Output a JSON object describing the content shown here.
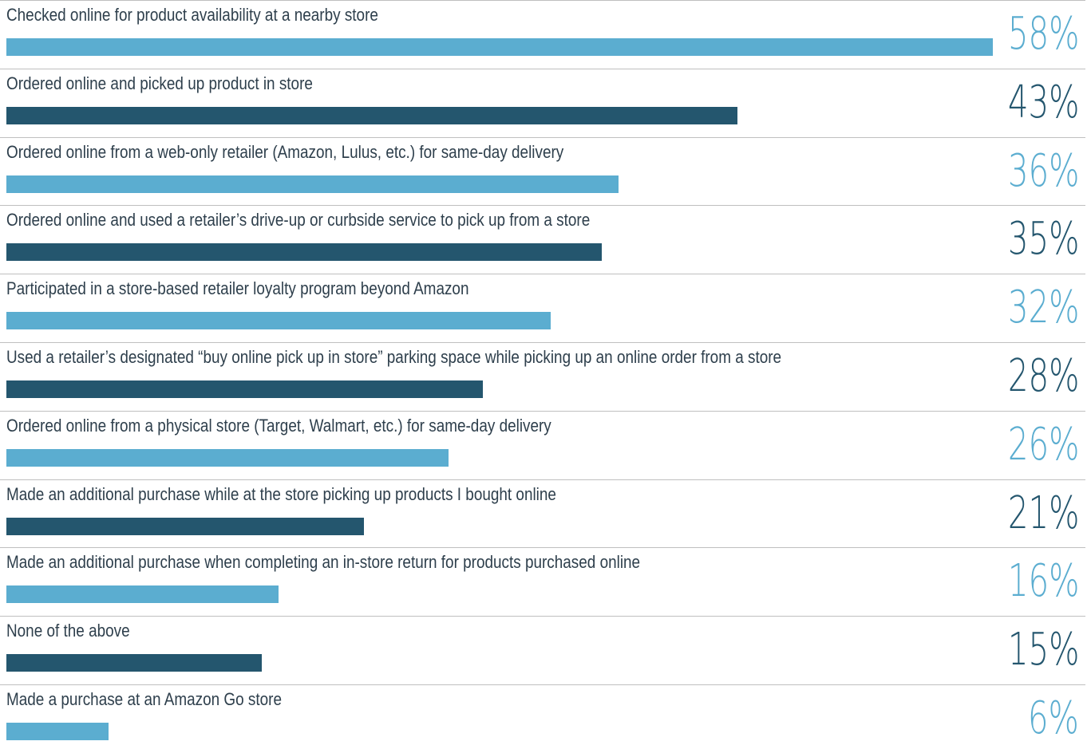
{
  "chart_data": {
    "type": "bar",
    "orientation": "horizontal",
    "value_suffix": "%",
    "categories": [
      "Checked online for product availability at a nearby store",
      "Ordered online and picked up product in store",
      "Ordered online from a web-only retailer (Amazon, Lulus, etc.) for same-day delivery",
      "Ordered online and used a retailer’s drive-up or curbside service to pick up from a store",
      "Participated in a store-based retailer loyalty program beyond Amazon",
      "Used a retailer’s designated “buy online pick up in store” parking space while picking up an online order from a store",
      "Ordered online from a physical store (Target, Walmart, etc.) for same-day delivery",
      "Made an additional purchase while at the store picking up products I bought online",
      "Made an additional purchase when completing an in-store return for products purchased online",
      "None of the above",
      "Made a purchase at an Amazon Go store"
    ],
    "values": [
      58,
      43,
      36,
      35,
      32,
      28,
      26,
      21,
      16,
      15,
      6
    ],
    "value_labels": [
      "58%",
      "43%",
      "36%",
      "35%",
      "32%",
      "28%",
      "26%",
      "21%",
      "16%",
      "15%",
      "6%"
    ],
    "colors": [
      "#5badd0",
      "#24566e"
    ],
    "grid": false,
    "legend": "none"
  }
}
